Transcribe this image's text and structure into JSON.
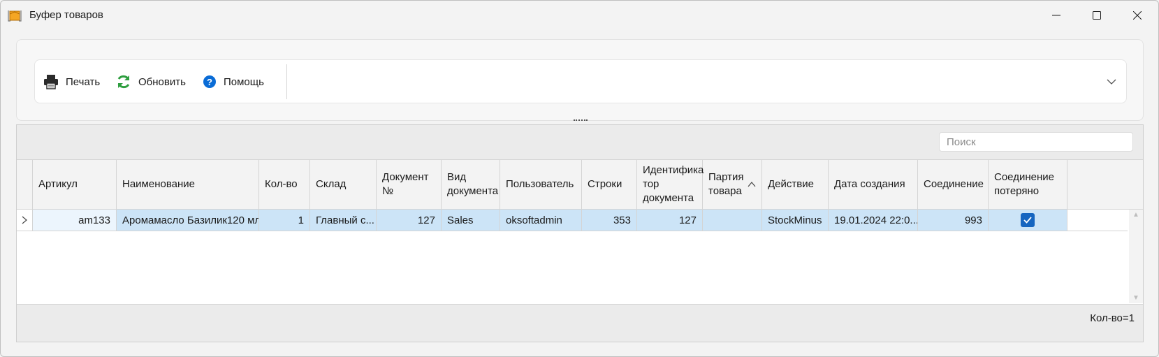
{
  "window": {
    "title": "Буфер товаров"
  },
  "toolbar": {
    "print_label": "Печать",
    "refresh_label": "Обновить",
    "help_label": "Помощь"
  },
  "search": {
    "placeholder": "Поиск",
    "value": ""
  },
  "grid": {
    "columns": [
      "Артикул",
      "Наименование",
      "Кол-во",
      "Склад",
      "Документ №",
      "Вид документа",
      "Пользователь",
      "Строки",
      "Идентификатор документа",
      "Партия товара",
      "Действие",
      "Дата создания",
      "Соединение",
      "Соединение потеряно"
    ],
    "header_display": {
      "doc_no": [
        "Документ",
        "№"
      ],
      "doc_type": [
        "Вид",
        "документа"
      ],
      "doc_id": [
        "Идентифика",
        "тор",
        "документа"
      ],
      "batch": [
        "Партия",
        "товара"
      ],
      "conn_lost": [
        "Соединение",
        "потеряно"
      ]
    },
    "sorted_column": "Партия товара",
    "rows": [
      {
        "article": "am133",
        "name": "Аромамасло Базилик120 мл",
        "qty": "1",
        "warehouse": "Главный с...",
        "doc_no": "127",
        "doc_type": "Sales",
        "user": "oksoftadmin",
        "lines": "353",
        "doc_id": "127",
        "batch": "",
        "action": "StockMinus",
        "created": "19.01.2024 22:0...",
        "connection": "993",
        "connection_lost": true
      }
    ]
  },
  "footer": {
    "count_label": "Кол-во=1"
  },
  "colors": {
    "selection": "#cce4f7",
    "checkbox": "#1565c0",
    "refresh": "#2e9e3f",
    "help": "#0a6cd6"
  }
}
